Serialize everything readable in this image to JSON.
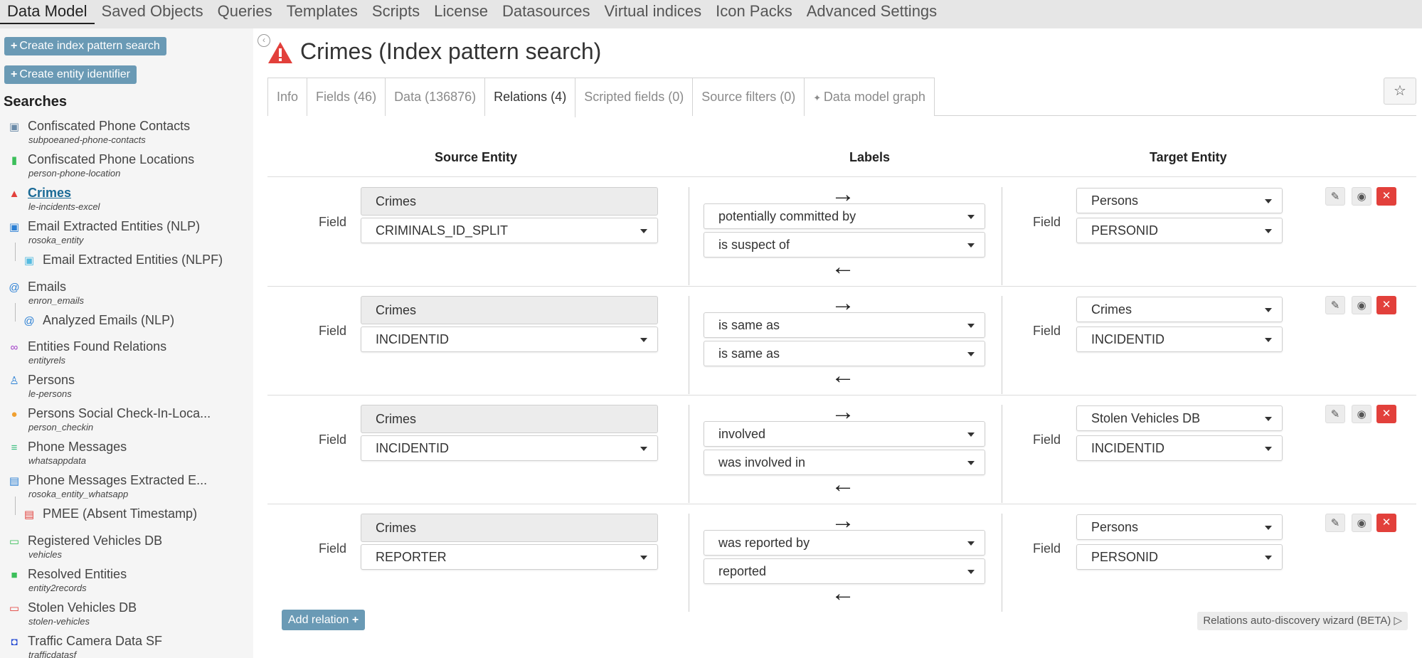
{
  "topnav": [
    "Data Model",
    "Saved Objects",
    "Queries",
    "Templates",
    "Scripts",
    "License",
    "Datasources",
    "Virtual indices",
    "Icon Packs",
    "Advanced Settings"
  ],
  "sidebar": {
    "btn_create_index_pattern": "Create index pattern search",
    "btn_create_entity_identifier": "Create entity identifier",
    "heading": "Searches",
    "items": [
      {
        "name": "Confiscated Phone Contacts",
        "sub": "subpoeaned-phone-contacts",
        "icon": "contact-card-icon",
        "color": "#6a8aa8"
      },
      {
        "name": "Confiscated Phone Locations",
        "sub": "person-phone-location",
        "icon": "phone-icon",
        "color": "#3cbf5a"
      },
      {
        "name": "Crimes",
        "sub": "le-incidents-excel",
        "icon": "warning-icon",
        "color": "#e2403b"
      },
      {
        "name": "Email Extracted Entities (NLP)",
        "sub": "rosoka_entity",
        "icon": "contact-badge-icon",
        "color": "#2a7fd4"
      },
      {
        "name": "Email Extracted Entities (NLPF)",
        "sub": "",
        "icon": "contact-badge-icon",
        "color": "#55bbe0"
      },
      {
        "name": "Emails",
        "sub": "enron_emails",
        "icon": "at-icon",
        "color": "#2a7fd4"
      },
      {
        "name": "Analyzed Emails (NLP)",
        "sub": "",
        "icon": "at-icon",
        "color": "#2a7fd4"
      },
      {
        "name": "Entities Found Relations",
        "sub": "entityrels",
        "icon": "link-icon",
        "color": "#a03cc8"
      },
      {
        "name": "Persons",
        "sub": "le-persons",
        "icon": "person-icon",
        "color": "#2a7fd4"
      },
      {
        "name": "Persons Social Check-In-Loca...",
        "sub": "person_checkin",
        "icon": "map-pin-icon",
        "color": "#f0a030"
      },
      {
        "name": "Phone Messages",
        "sub": "whatsappdata",
        "icon": "lines-icon",
        "color": "#3cbf80"
      },
      {
        "name": "Phone Messages Extracted E...",
        "sub": "rosoka_entity_whatsapp",
        "icon": "id-card-icon",
        "color": "#2a7fd4"
      },
      {
        "name": "PMEE (Absent Timestamp)",
        "sub": "",
        "icon": "id-card-icon",
        "color": "#e2403b"
      },
      {
        "name": "Registered Vehicles DB",
        "sub": "vehicles",
        "icon": "car-icon",
        "color": "#3cbf5a"
      },
      {
        "name": "Resolved Entities",
        "sub": "entity2records",
        "icon": "cube-icon",
        "color": "#3cbf5a"
      },
      {
        "name": "Stolen Vehicles DB",
        "sub": "stolen-vehicles",
        "icon": "car-icon",
        "color": "#e2403b"
      },
      {
        "name": "Traffic Camera Data SF",
        "sub": "trafficdatasf",
        "icon": "map-marked-icon",
        "color": "#2a4fd4"
      }
    ]
  },
  "main": {
    "title": "Crimes (Index pattern search)",
    "tabs": [
      "Info",
      "Fields (46)",
      "Data (136876)",
      "Relations (4)",
      "Scripted fields (0)",
      "Source filters (0)",
      "Data model graph"
    ],
    "active_tab": "Relations (4)",
    "columns": {
      "source": "Source Entity",
      "labels": "Labels",
      "target": "Target Entity"
    },
    "field_label": "Field",
    "relations": [
      {
        "source_entity": "Crimes",
        "source_field": "CRIMINALS_ID_SPLIT",
        "label_forward": "potentially committed by",
        "label_backward": "is suspect of",
        "target_entity": "Persons",
        "target_field": "PERSONID"
      },
      {
        "source_entity": "Crimes",
        "source_field": "INCIDENTID",
        "label_forward": "is same as",
        "label_backward": "is same as",
        "target_entity": "Crimes",
        "target_field": "INCIDENTID"
      },
      {
        "source_entity": "Crimes",
        "source_field": "INCIDENTID",
        "label_forward": "involved",
        "label_backward": "was involved in",
        "target_entity": "Stolen Vehicles DB",
        "target_field": "INCIDENTID"
      },
      {
        "source_entity": "Crimes",
        "source_field": "REPORTER",
        "label_forward": "was reported by",
        "label_backward": "reported",
        "target_entity": "Persons",
        "target_field": "PERSONID"
      }
    ],
    "add_relation": "Add relation",
    "wizard": "Relations auto-discovery wizard (BETA)"
  }
}
